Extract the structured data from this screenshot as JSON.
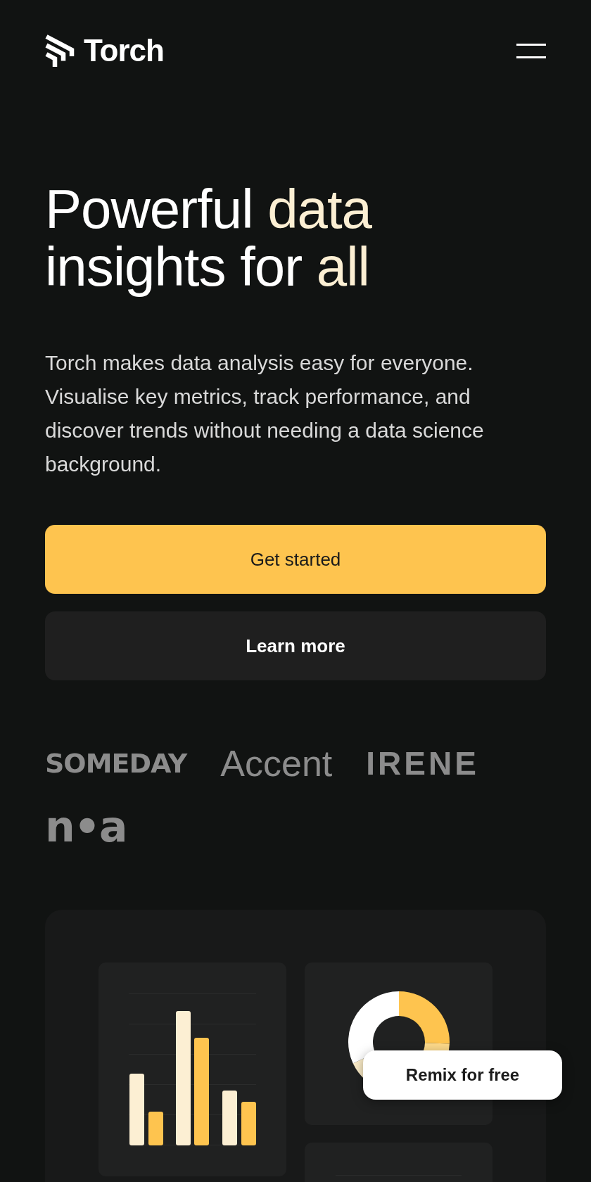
{
  "header": {
    "brand": "Torch"
  },
  "hero": {
    "headline": [
      {
        "text": "Powerful ",
        "highlight": false
      },
      {
        "text": "data",
        "highlight": true
      },
      {
        "text": " insights for ",
        "highlight": false
      },
      {
        "text": "all",
        "highlight": true
      }
    ],
    "description": "Torch makes data analysis easy for everyone. Visualise key metrics, track performance, and discover trends without needing a data science background."
  },
  "buttons": [
    {
      "label": "Get started",
      "kind": "primary"
    },
    {
      "label": "Learn more",
      "kind": "secondary"
    }
  ],
  "logos": [
    {
      "name": "SOMEDAY",
      "kind": "heavy"
    },
    {
      "name": "Accent",
      "kind": "light"
    },
    {
      "name": "IRENE",
      "kind": "spaced"
    },
    {
      "name": "n•a",
      "kind": "rounded"
    }
  ],
  "preview": {
    "badge": "Remix for free"
  }
}
